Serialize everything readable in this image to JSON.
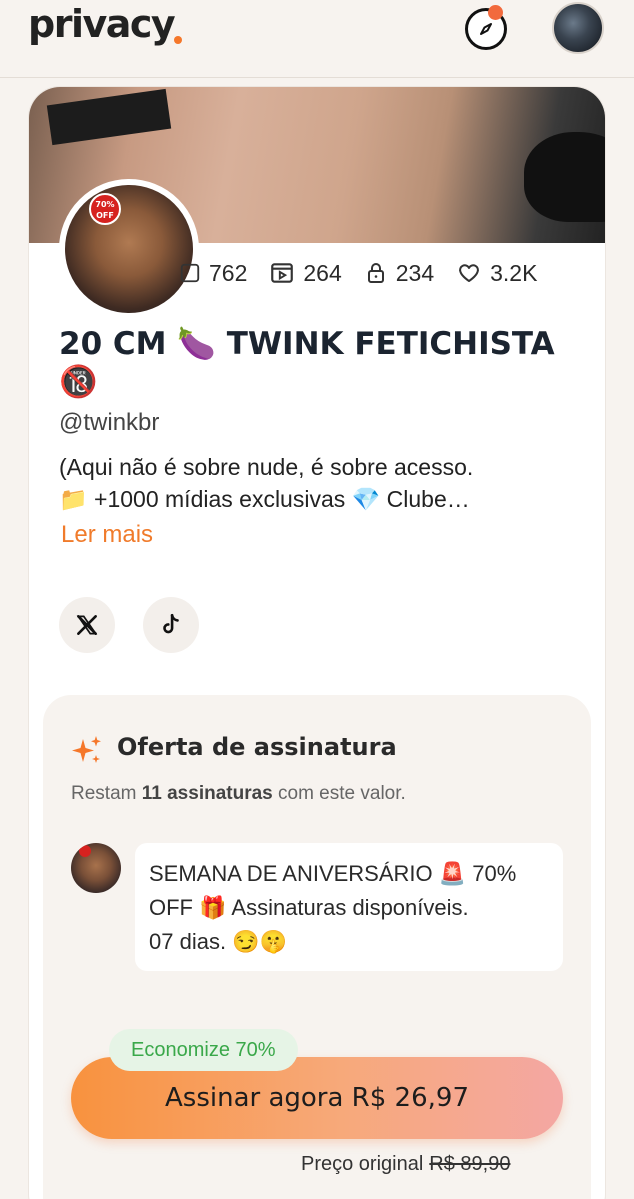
{
  "header": {
    "logo_text": "privacy",
    "explore_icon": "compass-icon",
    "user_avatar": "avatar"
  },
  "profile": {
    "discount_badge": "70% OFF",
    "stats": {
      "media": "762",
      "videos": "264",
      "locked": "234",
      "likes": "3.2K"
    },
    "title_line1": "20 CM 🍆 TWINK FETICHISTA",
    "title_line2": "🔞",
    "handle": "@twinkbr",
    "bio_line1": "(Aqui não é sobre nude, é sobre acesso.",
    "bio_line2": "📁 +1000 mídias exclusivas 💎 Clube…",
    "read_more": "Ler mais",
    "socials": [
      "x-icon",
      "tiktok-icon"
    ]
  },
  "offer": {
    "title": "Oferta de assinatura",
    "remaining_prefix": "Restam ",
    "remaining_bold": "11 assinaturas",
    "remaining_suffix": " com este valor.",
    "message_line1": "SEMANA DE ANIVERSÁRIO 🚨 70%",
    "message_line2": "OFF 🎁 Assinaturas disponíveis.",
    "message_line3": "07 dias. 😏🤫",
    "save_label": "Economize 70%",
    "subscribe_label": "Assinar agora R$ 26,97",
    "original_label": "Preço original",
    "original_price": "R$ 89,90"
  },
  "colors": {
    "accent": "#f07b2b",
    "save_green": "#3aa84a",
    "background": "#f7f3ef"
  }
}
